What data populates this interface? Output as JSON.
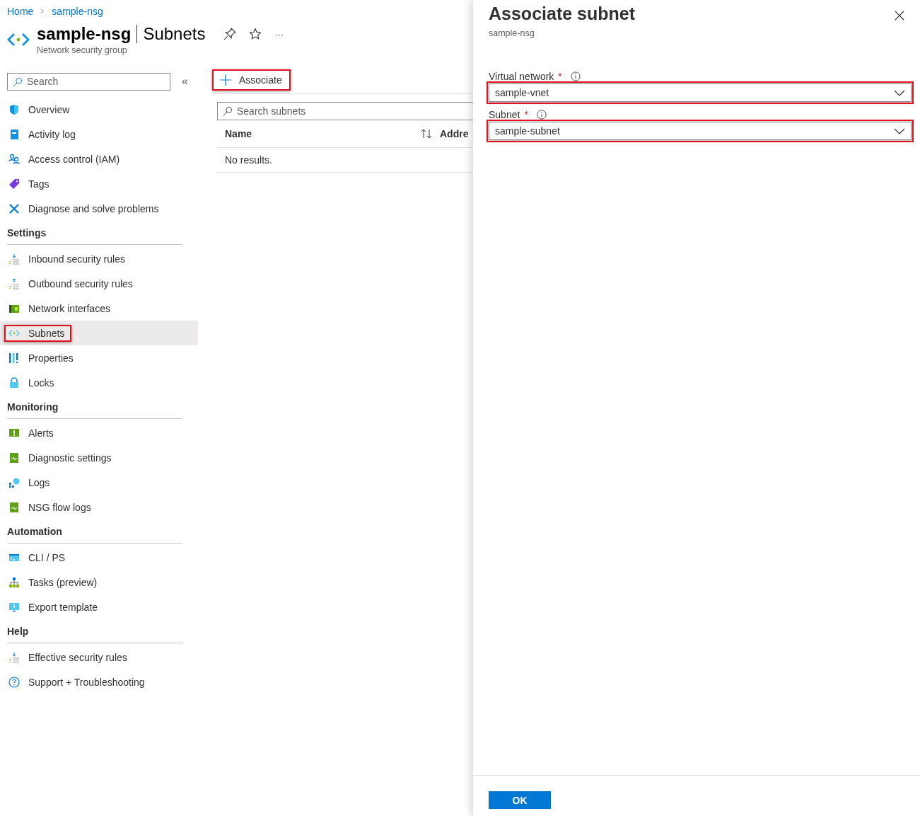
{
  "breadcrumb": [
    {
      "label": "Home"
    },
    {
      "label": "sample-nsg"
    }
  ],
  "header": {
    "resource": "sample-nsg",
    "page": "Subnets",
    "subtitle": "Network security group",
    "more": "···"
  },
  "sidebar": {
    "search": {
      "placeholder": "Search"
    },
    "collapse": "«",
    "sections": [
      {
        "items": [
          {
            "label": "Overview",
            "selected": false,
            "highlighted": false
          },
          {
            "label": "Activity log",
            "selected": false,
            "highlighted": false
          },
          {
            "label": "Access control (IAM)",
            "selected": false,
            "highlighted": false
          },
          {
            "label": "Tags",
            "selected": false,
            "highlighted": false
          },
          {
            "label": "Diagnose and solve problems",
            "selected": false,
            "highlighted": false
          }
        ]
      },
      {
        "heading": "Settings",
        "items": [
          {
            "label": "Inbound security rules",
            "selected": false,
            "highlighted": false
          },
          {
            "label": "Outbound security rules",
            "selected": false,
            "highlighted": false
          },
          {
            "label": "Network interfaces",
            "selected": false,
            "highlighted": false
          },
          {
            "label": "Subnets",
            "selected": true,
            "highlighted": true
          },
          {
            "label": "Properties",
            "selected": false,
            "highlighted": false
          },
          {
            "label": "Locks",
            "selected": false,
            "highlighted": false
          }
        ]
      },
      {
        "heading": "Monitoring",
        "items": [
          {
            "label": "Alerts",
            "selected": false,
            "highlighted": false
          },
          {
            "label": "Diagnostic settings",
            "selected": false,
            "highlighted": false
          },
          {
            "label": "Logs",
            "selected": false,
            "highlighted": false
          },
          {
            "label": "NSG flow logs",
            "selected": false,
            "highlighted": false
          }
        ]
      },
      {
        "heading": "Automation",
        "items": [
          {
            "label": "CLI / PS",
            "selected": false,
            "highlighted": false
          },
          {
            "label": "Tasks (preview)",
            "selected": false,
            "highlighted": false
          },
          {
            "label": "Export template",
            "selected": false,
            "highlighted": false
          }
        ]
      },
      {
        "heading": "Help",
        "items": [
          {
            "label": "Effective security rules",
            "selected": false,
            "highlighted": false
          },
          {
            "label": "Support + Troubleshooting",
            "selected": false,
            "highlighted": false
          }
        ]
      }
    ]
  },
  "toolbar": [
    {
      "label": "Associate",
      "highlighted": true
    }
  ],
  "search": {
    "placeholder": "Search subnets"
  },
  "table": {
    "columns": [
      {
        "label": "Name",
        "sortable": true
      },
      {
        "label": "Addre",
        "sortable": false
      }
    ],
    "empty": "No results."
  },
  "panel": {
    "title": "Associate subnet",
    "subtitle": "sample-nsg",
    "fields": [
      {
        "label": "Virtual network",
        "required_mark": "*",
        "value": "sample-vnet",
        "highlighted": true
      },
      {
        "label": "Subnet",
        "required_mark": "*",
        "value": "sample-subnet",
        "highlighted": true
      }
    ],
    "buttons": [
      {
        "label": "OK"
      }
    ]
  }
}
